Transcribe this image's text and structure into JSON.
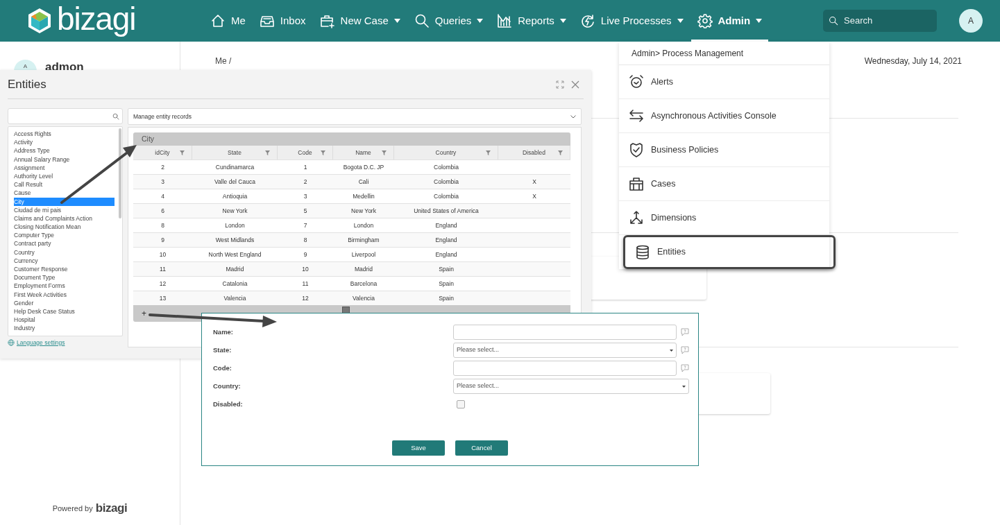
{
  "topbar": {
    "logo": "bizagi",
    "nav": [
      {
        "label": "Me",
        "caret": false,
        "selected": false
      },
      {
        "label": "Inbox",
        "caret": false,
        "selected": false
      },
      {
        "label": "New Case",
        "caret": true,
        "selected": false
      },
      {
        "label": "Queries",
        "caret": true,
        "selected": false
      },
      {
        "label": "Reports",
        "caret": true,
        "selected": false
      },
      {
        "label": "Live Processes",
        "caret": true,
        "selected": false
      },
      {
        "label": "Admin",
        "caret": true,
        "selected": true
      }
    ],
    "search": {
      "placeholder": "Search"
    },
    "avatar": "A"
  },
  "sidebar": {
    "avatar": "A",
    "user": "admon",
    "powered_by": "Powered by",
    "brand": "bizagi"
  },
  "main": {
    "breadcrumb": "Me /",
    "date": "Wednesday, July 14, 2021"
  },
  "admin_menu": {
    "header": "Admin> Process Management",
    "items": [
      {
        "label": "Alerts",
        "selected": false
      },
      {
        "label": "Asynchronous Activities Console",
        "selected": false
      },
      {
        "label": "Business Policies",
        "selected": false
      },
      {
        "label": "Cases",
        "selected": false
      },
      {
        "label": "Dimensions",
        "selected": false
      },
      {
        "label": "Entities",
        "selected": true
      }
    ]
  },
  "entities_window": {
    "title": "Entities",
    "entities": [
      {
        "label": "Access Rights",
        "selected": false
      },
      {
        "label": "Activity",
        "selected": false
      },
      {
        "label": "Address Type",
        "selected": false
      },
      {
        "label": "Annual Salary Range",
        "selected": false
      },
      {
        "label": "Assignment",
        "selected": false
      },
      {
        "label": "Authority Level",
        "selected": false
      },
      {
        "label": "Call Result",
        "selected": false
      },
      {
        "label": "Cause",
        "selected": false
      },
      {
        "label": "City",
        "selected": true
      },
      {
        "label": "Ciudad de mi pais",
        "selected": false
      },
      {
        "label": "Claims and Complaints Action",
        "selected": false
      },
      {
        "label": "Closing Notification Mean",
        "selected": false
      },
      {
        "label": "Computer Type",
        "selected": false
      },
      {
        "label": "Contract party",
        "selected": false
      },
      {
        "label": "Country",
        "selected": false
      },
      {
        "label": "Currency",
        "selected": false
      },
      {
        "label": "Customer Response",
        "selected": false
      },
      {
        "label": "Document Type",
        "selected": false
      },
      {
        "label": "Employment Forms",
        "selected": false
      },
      {
        "label": "First Week Activities",
        "selected": false
      },
      {
        "label": "Gender",
        "selected": false
      },
      {
        "label": "Help Desk Case Status",
        "selected": false
      },
      {
        "label": "Hospital",
        "selected": false
      },
      {
        "label": "Industry",
        "selected": false
      }
    ],
    "language_link": "Language settings",
    "mode": "Manage entity records",
    "table": {
      "caption": "City",
      "columns": [
        "idCity",
        "State",
        "Code",
        "Name",
        "Country",
        "Disabled"
      ],
      "rows": [
        [
          "2",
          "Cundinamarca",
          "1",
          "Bogota D.C. JP",
          "Colombia",
          ""
        ],
        [
          "3",
          "Valle del Cauca",
          "2",
          "Cali",
          "Colombia",
          "X"
        ],
        [
          "4",
          "Antioquia",
          "3",
          "Medellin",
          "Colombia",
          "X"
        ],
        [
          "6",
          "New York",
          "5",
          "New York",
          "United States of America",
          ""
        ],
        [
          "8",
          "London",
          "7",
          "London",
          "England",
          ""
        ],
        [
          "9",
          "West Midlands",
          "8",
          "Birmingham",
          "England",
          ""
        ],
        [
          "10",
          "North West England",
          "9",
          "Liverpool",
          "England",
          ""
        ],
        [
          "11",
          "Madrid",
          "10",
          "Madrid",
          "Spain",
          ""
        ],
        [
          "12",
          "Catalonia",
          "11",
          "Barcelona",
          "Spain",
          ""
        ],
        [
          "13",
          "Valencia",
          "12",
          "Valencia",
          "Spain",
          ""
        ]
      ],
      "add": "+"
    }
  },
  "record_form": {
    "fields": [
      {
        "label": "Name:",
        "kind": "text",
        "help": true
      },
      {
        "label": "State:",
        "kind": "select",
        "placeholder": "Please select...",
        "help": true
      },
      {
        "label": "Code:",
        "kind": "text",
        "help": true
      },
      {
        "label": "Country:",
        "kind": "select",
        "placeholder": "Please select...",
        "help": false
      },
      {
        "label": "Disabled:",
        "kind": "checkbox",
        "checked": false
      }
    ],
    "buttons": [
      "Save",
      "Cancel"
    ]
  }
}
